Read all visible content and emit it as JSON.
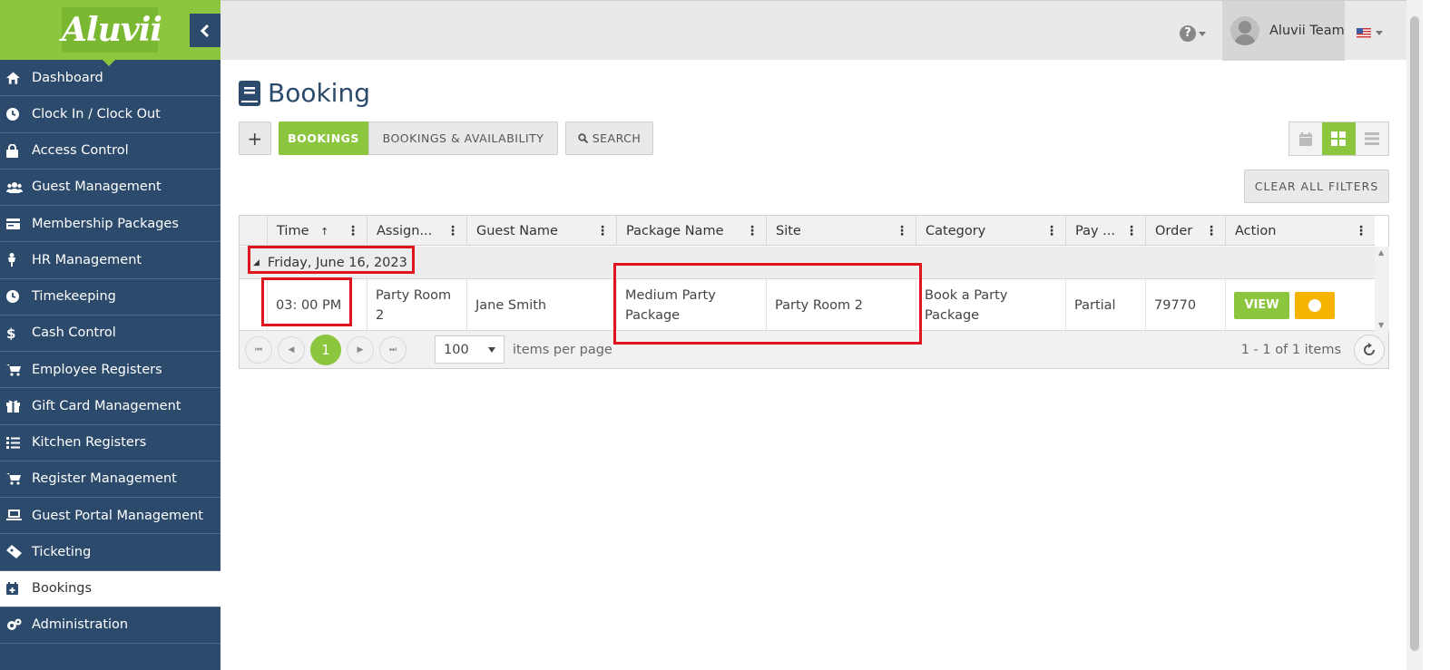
{
  "brand": {
    "logo_text": "Aluvii",
    "accent": "#8cc63f",
    "sidebar_bg": "#2c4a6b",
    "highlight_color": "#e0141e"
  },
  "sidebar": {
    "items": [
      {
        "label": "Dashboard",
        "icon": "home-icon"
      },
      {
        "label": "Clock In / Clock Out",
        "icon": "clock-icon"
      },
      {
        "label": "Access Control",
        "icon": "lock-icon"
      },
      {
        "label": "Guest Management",
        "icon": "users-icon"
      },
      {
        "label": "Membership Packages",
        "icon": "card-icon"
      },
      {
        "label": "HR Management",
        "icon": "person-icon"
      },
      {
        "label": "Timekeeping",
        "icon": "clock-icon"
      },
      {
        "label": "Cash Control",
        "icon": "dollar-icon"
      },
      {
        "label": "Employee Registers",
        "icon": "cart-icon"
      },
      {
        "label": "Gift Card Management",
        "icon": "gift-icon"
      },
      {
        "label": "Kitchen Registers",
        "icon": "list-icon"
      },
      {
        "label": "Register Management",
        "icon": "cart-plus-icon"
      },
      {
        "label": "Guest Portal Management",
        "icon": "laptop-icon"
      },
      {
        "label": "Ticketing",
        "icon": "ticket-icon"
      },
      {
        "label": "Bookings",
        "icon": "calendar-plus-icon",
        "active": true
      },
      {
        "label": "Administration",
        "icon": "cogs-icon"
      }
    ]
  },
  "header": {
    "user_name": "Aluvii Team",
    "help_icon": "question-icon",
    "language_flag": "us-flag-icon"
  },
  "page": {
    "title": "Booking"
  },
  "toolbar": {
    "add_label": "+",
    "tabs": [
      "BOOKINGS",
      "BOOKINGS & AVAILABILITY"
    ],
    "active_tab": "BOOKINGS",
    "search_label": "SEARCH",
    "clear_filters_label": "CLEAR ALL FILTERS",
    "view_modes": [
      "calendar-view",
      "grid-view",
      "list-view"
    ],
    "active_view": "grid-view"
  },
  "grid": {
    "columns": [
      "Time",
      "Assign...",
      "Guest Name",
      "Package Name",
      "Site",
      "Category",
      "Pay ...",
      "Order",
      "Action"
    ],
    "sort_indicator": "↑",
    "group_label": "Friday, June 16, 2023",
    "rows": [
      {
        "time": "03: 00 PM",
        "assigned": "Party Room 2",
        "guest_name": "Jane Smith",
        "package_name": "Medium Party Package",
        "site": "Party Room 2",
        "category": "Book a Party Package",
        "payment": "Partial",
        "order": "79770",
        "action_view": "VIEW"
      }
    ]
  },
  "pager": {
    "current_page": "1",
    "page_size": "100",
    "items_per_page_label": "items per page",
    "summary": "1 - 1 of 1 items"
  }
}
